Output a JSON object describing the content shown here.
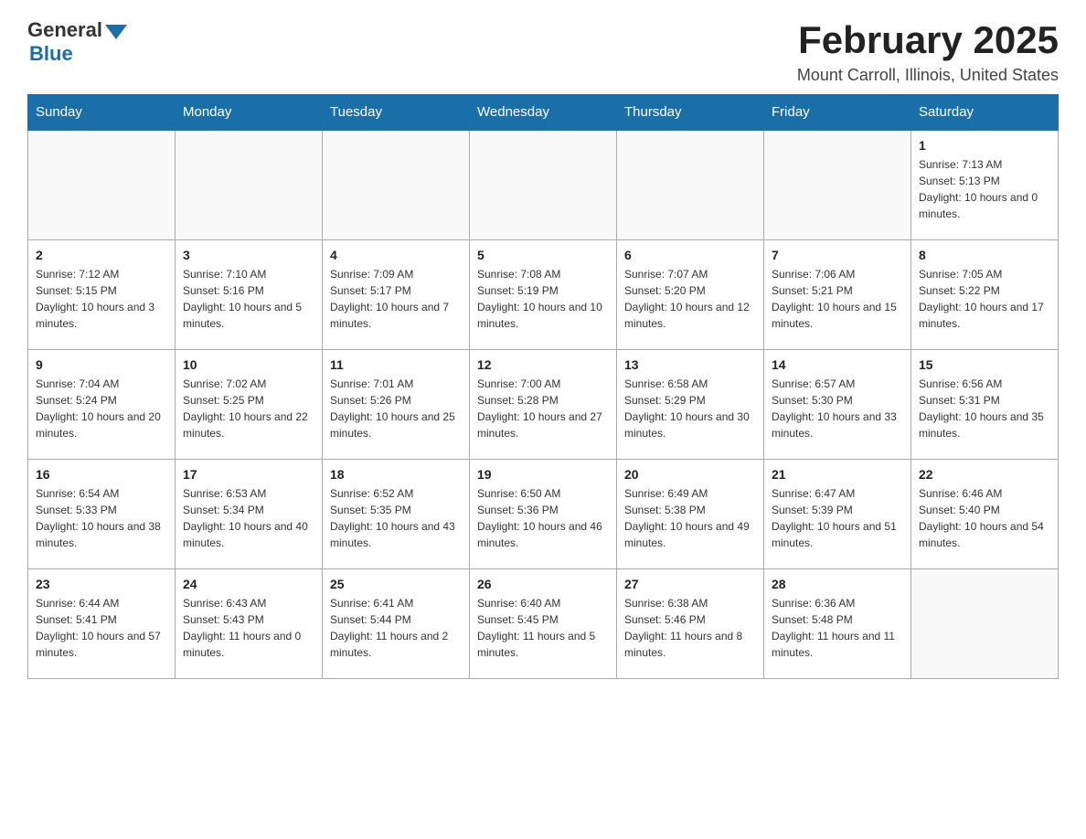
{
  "header": {
    "logo_general": "General",
    "logo_blue": "Blue",
    "title": "February 2025",
    "subtitle": "Mount Carroll, Illinois, United States"
  },
  "days_of_week": [
    "Sunday",
    "Monday",
    "Tuesday",
    "Wednesday",
    "Thursday",
    "Friday",
    "Saturday"
  ],
  "weeks": [
    [
      {
        "day": "",
        "info": ""
      },
      {
        "day": "",
        "info": ""
      },
      {
        "day": "",
        "info": ""
      },
      {
        "day": "",
        "info": ""
      },
      {
        "day": "",
        "info": ""
      },
      {
        "day": "",
        "info": ""
      },
      {
        "day": "1",
        "info": "Sunrise: 7:13 AM\nSunset: 5:13 PM\nDaylight: 10 hours and 0 minutes."
      }
    ],
    [
      {
        "day": "2",
        "info": "Sunrise: 7:12 AM\nSunset: 5:15 PM\nDaylight: 10 hours and 3 minutes."
      },
      {
        "day": "3",
        "info": "Sunrise: 7:10 AM\nSunset: 5:16 PM\nDaylight: 10 hours and 5 minutes."
      },
      {
        "day": "4",
        "info": "Sunrise: 7:09 AM\nSunset: 5:17 PM\nDaylight: 10 hours and 7 minutes."
      },
      {
        "day": "5",
        "info": "Sunrise: 7:08 AM\nSunset: 5:19 PM\nDaylight: 10 hours and 10 minutes."
      },
      {
        "day": "6",
        "info": "Sunrise: 7:07 AM\nSunset: 5:20 PM\nDaylight: 10 hours and 12 minutes."
      },
      {
        "day": "7",
        "info": "Sunrise: 7:06 AM\nSunset: 5:21 PM\nDaylight: 10 hours and 15 minutes."
      },
      {
        "day": "8",
        "info": "Sunrise: 7:05 AM\nSunset: 5:22 PM\nDaylight: 10 hours and 17 minutes."
      }
    ],
    [
      {
        "day": "9",
        "info": "Sunrise: 7:04 AM\nSunset: 5:24 PM\nDaylight: 10 hours and 20 minutes."
      },
      {
        "day": "10",
        "info": "Sunrise: 7:02 AM\nSunset: 5:25 PM\nDaylight: 10 hours and 22 minutes."
      },
      {
        "day": "11",
        "info": "Sunrise: 7:01 AM\nSunset: 5:26 PM\nDaylight: 10 hours and 25 minutes."
      },
      {
        "day": "12",
        "info": "Sunrise: 7:00 AM\nSunset: 5:28 PM\nDaylight: 10 hours and 27 minutes."
      },
      {
        "day": "13",
        "info": "Sunrise: 6:58 AM\nSunset: 5:29 PM\nDaylight: 10 hours and 30 minutes."
      },
      {
        "day": "14",
        "info": "Sunrise: 6:57 AM\nSunset: 5:30 PM\nDaylight: 10 hours and 33 minutes."
      },
      {
        "day": "15",
        "info": "Sunrise: 6:56 AM\nSunset: 5:31 PM\nDaylight: 10 hours and 35 minutes."
      }
    ],
    [
      {
        "day": "16",
        "info": "Sunrise: 6:54 AM\nSunset: 5:33 PM\nDaylight: 10 hours and 38 minutes."
      },
      {
        "day": "17",
        "info": "Sunrise: 6:53 AM\nSunset: 5:34 PM\nDaylight: 10 hours and 40 minutes."
      },
      {
        "day": "18",
        "info": "Sunrise: 6:52 AM\nSunset: 5:35 PM\nDaylight: 10 hours and 43 minutes."
      },
      {
        "day": "19",
        "info": "Sunrise: 6:50 AM\nSunset: 5:36 PM\nDaylight: 10 hours and 46 minutes."
      },
      {
        "day": "20",
        "info": "Sunrise: 6:49 AM\nSunset: 5:38 PM\nDaylight: 10 hours and 49 minutes."
      },
      {
        "day": "21",
        "info": "Sunrise: 6:47 AM\nSunset: 5:39 PM\nDaylight: 10 hours and 51 minutes."
      },
      {
        "day": "22",
        "info": "Sunrise: 6:46 AM\nSunset: 5:40 PM\nDaylight: 10 hours and 54 minutes."
      }
    ],
    [
      {
        "day": "23",
        "info": "Sunrise: 6:44 AM\nSunset: 5:41 PM\nDaylight: 10 hours and 57 minutes."
      },
      {
        "day": "24",
        "info": "Sunrise: 6:43 AM\nSunset: 5:43 PM\nDaylight: 11 hours and 0 minutes."
      },
      {
        "day": "25",
        "info": "Sunrise: 6:41 AM\nSunset: 5:44 PM\nDaylight: 11 hours and 2 minutes."
      },
      {
        "day": "26",
        "info": "Sunrise: 6:40 AM\nSunset: 5:45 PM\nDaylight: 11 hours and 5 minutes."
      },
      {
        "day": "27",
        "info": "Sunrise: 6:38 AM\nSunset: 5:46 PM\nDaylight: 11 hours and 8 minutes."
      },
      {
        "day": "28",
        "info": "Sunrise: 6:36 AM\nSunset: 5:48 PM\nDaylight: 11 hours and 11 minutes."
      },
      {
        "day": "",
        "info": ""
      }
    ]
  ]
}
